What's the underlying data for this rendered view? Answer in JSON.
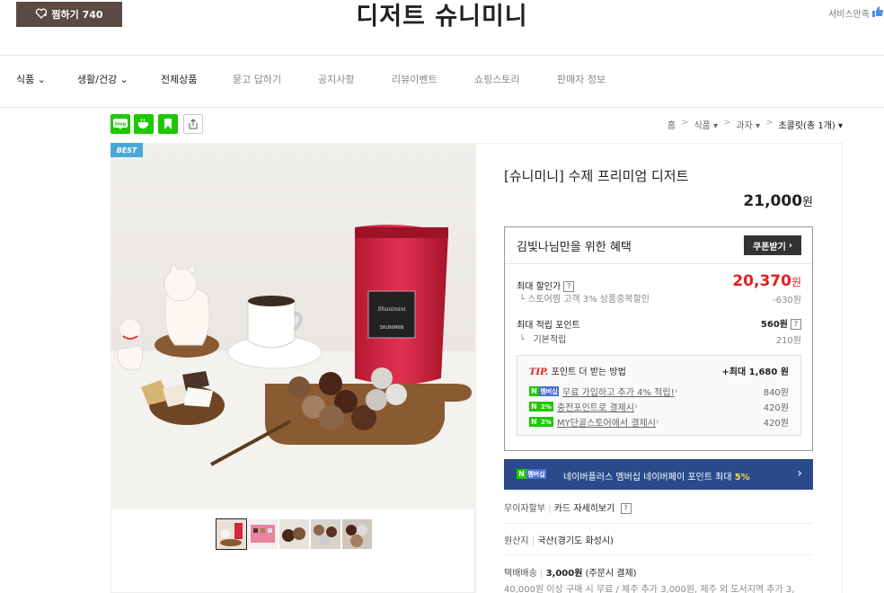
{
  "header": {
    "wish_label": "찜하기 740",
    "store_title": "디저트 슈니미니",
    "satisfaction": "서비스만족"
  },
  "nav": [
    {
      "label": "식품",
      "dropdown": true,
      "dark": true
    },
    {
      "label": "생활/건강",
      "dropdown": true,
      "dark": true
    },
    {
      "label": "전체상품",
      "dropdown": false,
      "dark": true
    },
    {
      "label": "묻고 답하기",
      "dropdown": false,
      "dark": false
    },
    {
      "label": "공지사항",
      "dropdown": false,
      "dark": false
    },
    {
      "label": "리뷰이벤트",
      "dropdown": false,
      "dark": false
    },
    {
      "label": "쇼핑스토리",
      "dropdown": false,
      "dark": false
    },
    {
      "label": "판매자 정보",
      "dropdown": false,
      "dark": false
    }
  ],
  "share_icons": [
    "blog-share-icon",
    "cafe-share-icon",
    "keep-share-icon",
    "share-icon"
  ],
  "breadcrumb": {
    "items": [
      "홈",
      "식품",
      "과자"
    ],
    "current": "초콜릿(총 1개)"
  },
  "image": {
    "best_label": "BEST",
    "package_brand": "SHUNIMINI",
    "package_script": "Shunimini"
  },
  "product": {
    "title": "[슈니미니] 수제 프리미엄 디저트",
    "price": "21,000",
    "won": "원"
  },
  "benefit": {
    "title": "김빛나님만을 위한 혜택",
    "coupon_label": "쿠폰받기",
    "max_discount_label": "최대 할인가",
    "max_discount_price": "20,370",
    "won": "원",
    "discount_note": "스토어찜 고객 3% 상품중복할인",
    "discount_amount": "-630원",
    "max_point_label": "최대 적립 포인트",
    "max_point": "560원",
    "basic_label": "기본적립",
    "basic_point": "210원",
    "tip_prefix": "TIP.",
    "tip_title": "포인트 더 받는 방법",
    "tip_max": "+최대 1,680 원",
    "tip_rows": [
      {
        "badge": "멤버십",
        "text": "무료 가입하고 추가 4% 적립!",
        "amount": "840원"
      },
      {
        "badge": "2%",
        "text": "충전포인트로 결제시",
        "amount": "420원"
      },
      {
        "badge": "2%",
        "text": "MY단골스토어에서 결제시",
        "amount": "420원"
      }
    ]
  },
  "npay_bar": {
    "badge": "멤버십",
    "text": "네이버플러스 멤버십 네이버페이 포인트 최대",
    "pct": "5%"
  },
  "specs": {
    "installment": "무이자할부",
    "card_detail": "카드 자세히보기",
    "origin_label": "원산지",
    "origin_value": "국산(경기도 화성시)",
    "shipping_label": "택배배송",
    "shipping_price": "3,000원",
    "shipping_note": "(주문시 결제)",
    "shipping_detail": "40,000원 이상 구매 시 무료 / 제주 추가 3,000원, 제주 외 도서지역 추가 3,"
  },
  "colors": {
    "wish_bg": "#5a4a43",
    "sale_red": "#e02020",
    "npay_bar": "#2b4a8c",
    "naver_green": "#1ec800",
    "best_blue": "#4aa8d8"
  }
}
